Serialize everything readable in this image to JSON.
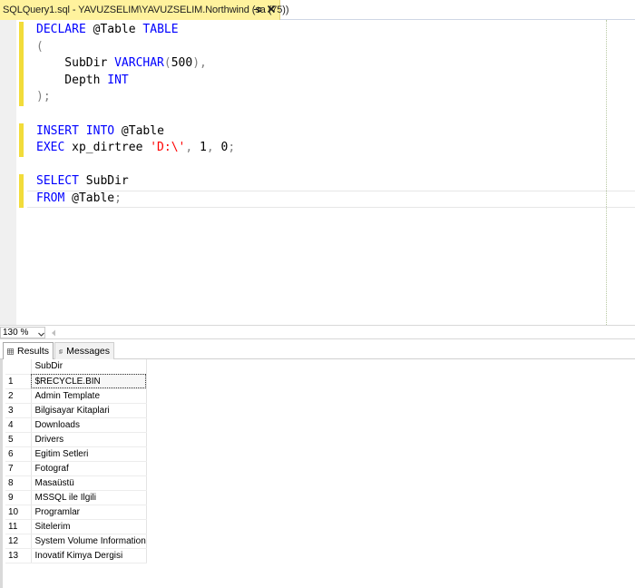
{
  "tab": {
    "title": "SQLQuery1.sql - YAVUZSELIM\\YAVUZSELIM.Northwind (sa (75))",
    "pin_icon": "pin-icon",
    "close_icon": "close-icon"
  },
  "editor": {
    "lines": [
      {
        "segments": [
          {
            "t": "DECLARE",
            "c": "kw"
          },
          {
            "t": " @Table ",
            "c": ""
          },
          {
            "t": "TABLE",
            "c": "kw"
          }
        ]
      },
      {
        "segments": [
          {
            "t": "(",
            "c": "op"
          }
        ]
      },
      {
        "segments": [
          {
            "t": "    SubDir ",
            "c": ""
          },
          {
            "t": "VARCHAR",
            "c": "kw"
          },
          {
            "t": "(",
            "c": "op"
          },
          {
            "t": "500",
            "c": ""
          },
          {
            "t": "),",
            "c": "op"
          }
        ]
      },
      {
        "segments": [
          {
            "t": "    Depth ",
            "c": ""
          },
          {
            "t": "INT",
            "c": "kw"
          }
        ]
      },
      {
        "segments": [
          {
            "t": ");",
            "c": "op"
          }
        ]
      },
      {
        "segments": []
      },
      {
        "segments": [
          {
            "t": "INSERT",
            "c": "kw"
          },
          {
            "t": " ",
            "c": ""
          },
          {
            "t": "INTO",
            "c": "kw"
          },
          {
            "t": " @Table",
            "c": ""
          }
        ]
      },
      {
        "segments": [
          {
            "t": "EXEC",
            "c": "kw"
          },
          {
            "t": " xp_dirtree ",
            "c": ""
          },
          {
            "t": "'D:\\'",
            "c": "str"
          },
          {
            "t": ",",
            "c": "op"
          },
          {
            "t": " 1",
            "c": ""
          },
          {
            "t": ",",
            "c": "op"
          },
          {
            "t": " 0",
            "c": ""
          },
          {
            "t": ";",
            "c": "op"
          }
        ]
      },
      {
        "segments": []
      },
      {
        "segments": [
          {
            "t": "SELECT",
            "c": "kw"
          },
          {
            "t": " SubDir",
            "c": ""
          }
        ]
      },
      {
        "segments": [
          {
            "t": "FROM",
            "c": "kw"
          },
          {
            "t": " @Table",
            "c": ""
          },
          {
            "t": ";",
            "c": "op"
          }
        ]
      }
    ]
  },
  "zoom": {
    "value": "130 %"
  },
  "result_tabs": {
    "results_label": "Results",
    "messages_label": "Messages"
  },
  "grid": {
    "column_header": "SubDir",
    "rows": [
      {
        "num": "1",
        "value": "$RECYCLE.BIN"
      },
      {
        "num": "2",
        "value": "Admin Template"
      },
      {
        "num": "3",
        "value": "Bilgisayar Kitaplari"
      },
      {
        "num": "4",
        "value": "Downloads"
      },
      {
        "num": "5",
        "value": "Drivers"
      },
      {
        "num": "6",
        "value": "Egitim Setleri"
      },
      {
        "num": "7",
        "value": "Fotograf"
      },
      {
        "num": "8",
        "value": "Masaüstü"
      },
      {
        "num": "9",
        "value": "MSSQL ile Ilgili"
      },
      {
        "num": "10",
        "value": "Programlar"
      },
      {
        "num": "11",
        "value": "Sitelerim"
      },
      {
        "num": "12",
        "value": "System Volume Information"
      },
      {
        "num": "13",
        "value": "Inovatif Kimya Dergisi"
      }
    ],
    "selected_row": 1
  },
  "colors": {
    "tab_active": "#fff29d",
    "keyword": "#0000ff",
    "string": "#ff0000",
    "change_marker": "#f2dc3a"
  }
}
